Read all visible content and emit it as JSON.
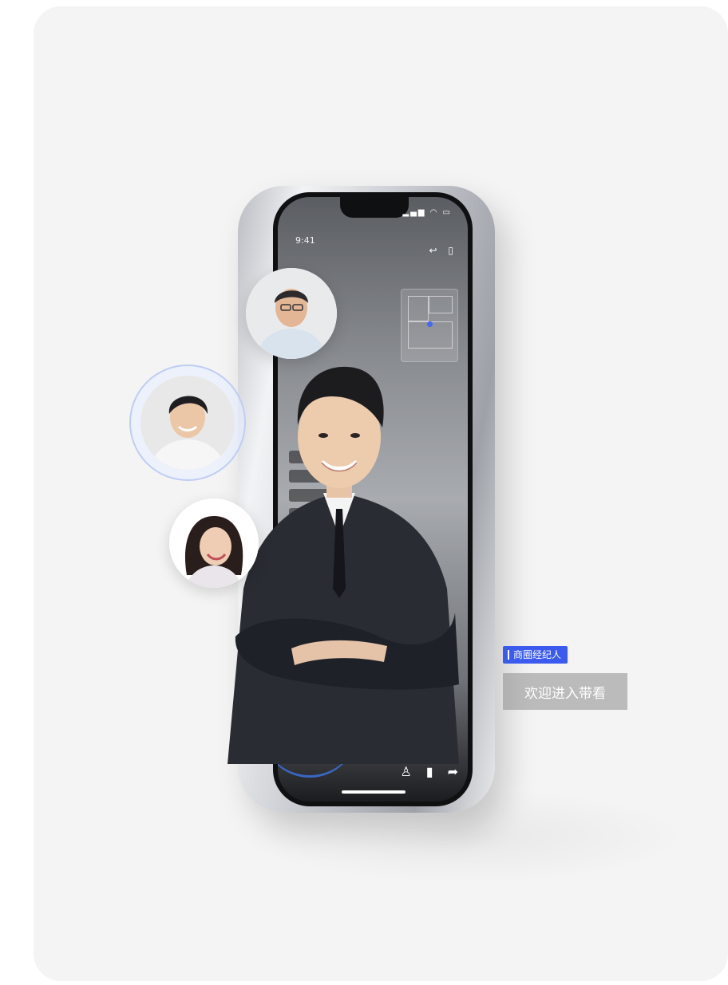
{
  "phone": {
    "time": "9:41",
    "status_icons": "▂▄▆ ◠ ▭",
    "top_icons": [
      "↩",
      "▯"
    ]
  },
  "overlay": {
    "agent_label": "商圈经纪人",
    "welcome_text": "欢迎进入带看"
  },
  "colors": {
    "accent": "#3b5bf0",
    "card_bg": "#f4f4f4"
  }
}
